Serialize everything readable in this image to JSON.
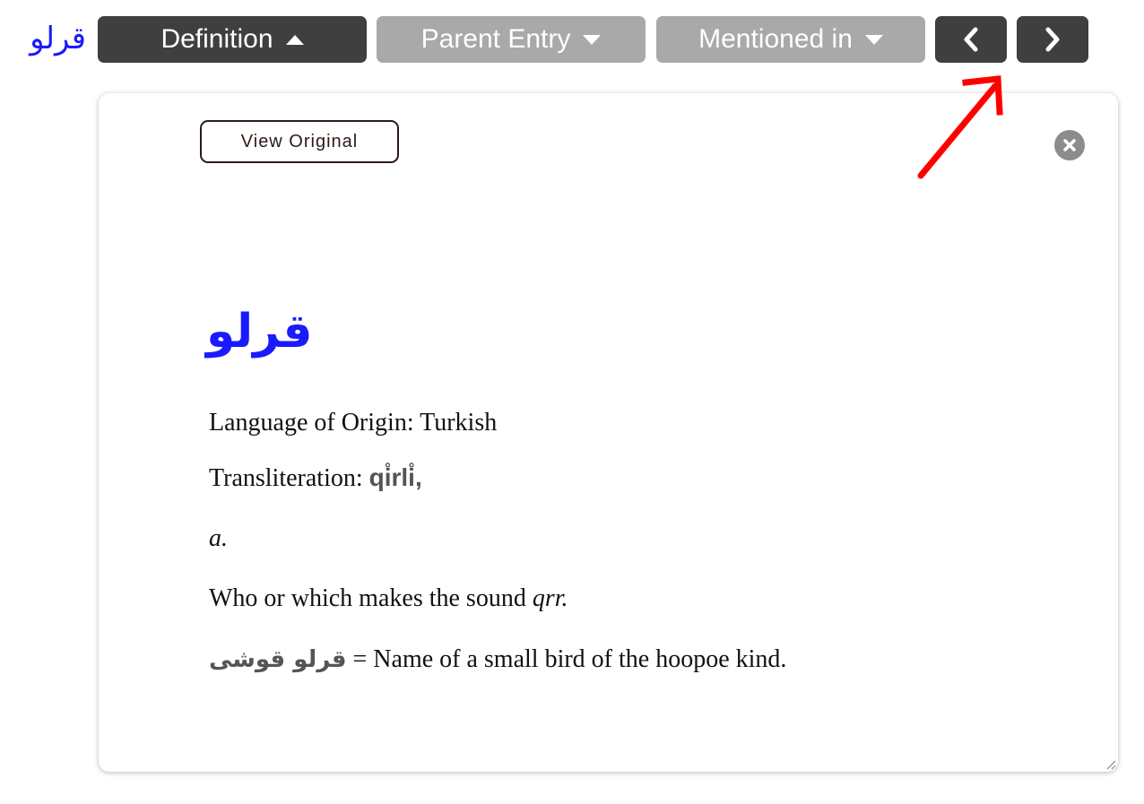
{
  "header": {
    "headword": "قرلو",
    "tabs": [
      {
        "label": "Definition",
        "caret": "caret-up-icon",
        "active": true
      },
      {
        "label": "Parent Entry",
        "caret": "caret-down-icon",
        "active": false
      },
      {
        "label": "Mentioned in",
        "caret": "caret-down-icon",
        "active": false
      }
    ],
    "nav": {
      "prev_icon": "chevron-left-icon",
      "next_icon": "chevron-right-icon"
    }
  },
  "panel": {
    "view_original_label": "View Original",
    "close_icon": "close-circle-icon",
    "entry_title": "قرلو",
    "origin_label": "Language of Origin: ",
    "origin_value": "Turkish",
    "translit_label": "Transliteration: ",
    "translit_value": "qi̊rli̊",
    "translit_suffix": ",",
    "pos": "a.",
    "definition_prefix": "Who or which makes the sound ",
    "definition_term": "qrr.",
    "phrase_urdu": "قرلو قوشی",
    "phrase_meaning": " = Name of a small bird of the hoopoe kind."
  },
  "colors": {
    "headword": "#1a1aff",
    "tab_active": "#3f3f3f",
    "tab_inactive": "#a9a9a9",
    "annotation_arrow": "#ff0000"
  }
}
